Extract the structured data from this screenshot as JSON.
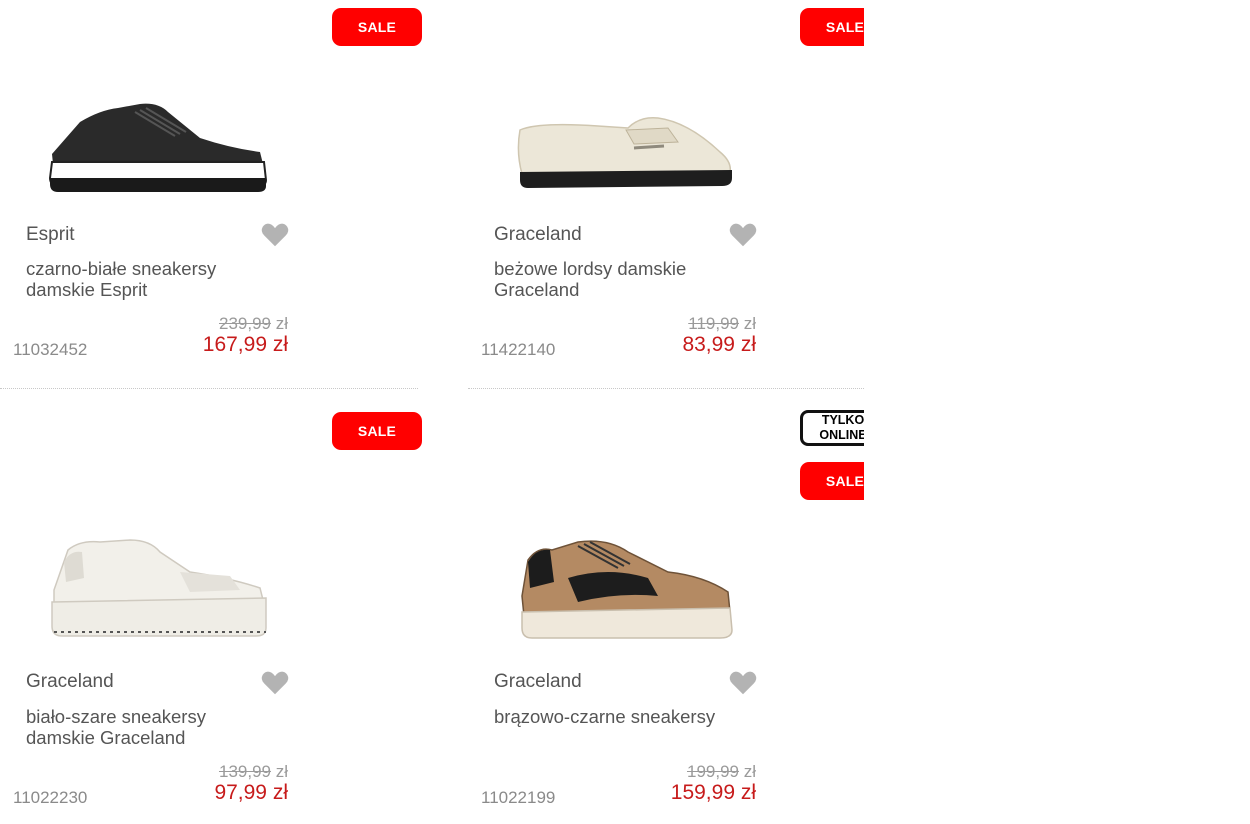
{
  "colors": {
    "sale_bg": "#ff0000",
    "price_new": "#c71b1b",
    "wishlist_icon": "#b3b3b3"
  },
  "badges": {
    "sale": "SALE",
    "online_line1": "TYLKO",
    "online_line2": "ONLINE"
  },
  "products": [
    {
      "brand": "Esprit",
      "name_line1": "czarno-białe sneakersy",
      "name_line2": "damskie Esprit",
      "old_price": "239,99",
      "currency": "zł",
      "new_price": "167,99 zł",
      "sku": "11032452",
      "icon": "heart-icon"
    },
    {
      "brand": "Graceland",
      "name_line1": "beżowe lordsy damskie",
      "name_line2": "Graceland",
      "old_price": "119,99",
      "currency": "zł",
      "new_price": "83,99 zł",
      "sku": "11422140",
      "icon": "heart-icon"
    },
    {
      "brand": "Graceland",
      "name_line1": "biało-szare sneakersy",
      "name_line2": "damskie Graceland",
      "old_price": "139,99",
      "currency": "zł",
      "new_price": "97,99 zł",
      "sku": "11022230",
      "icon": "heart-icon"
    },
    {
      "brand": "Graceland",
      "name_line1": "brązowo-czarne sneakersy",
      "name_line2": "",
      "old_price": "199,99",
      "currency": "zł",
      "new_price": "159,99 zł",
      "sku": "11022199",
      "icon": "heart-icon"
    }
  ]
}
